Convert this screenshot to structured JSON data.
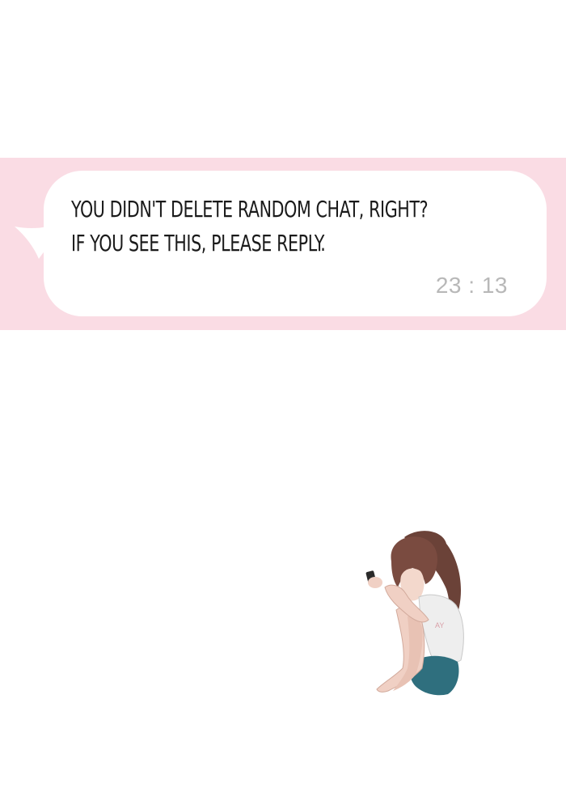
{
  "chat": {
    "message_lines": [
      "YOU DIDN'T DELETE RANDOM CHAT, RIGHT?",
      "IF YOU SEE THIS, PLEASE REPLY."
    ],
    "timestamp": "23 : 13"
  },
  "colors": {
    "band": "#fadce4",
    "bubble": "#ffffff",
    "timestamp": "#b8b8b8"
  }
}
